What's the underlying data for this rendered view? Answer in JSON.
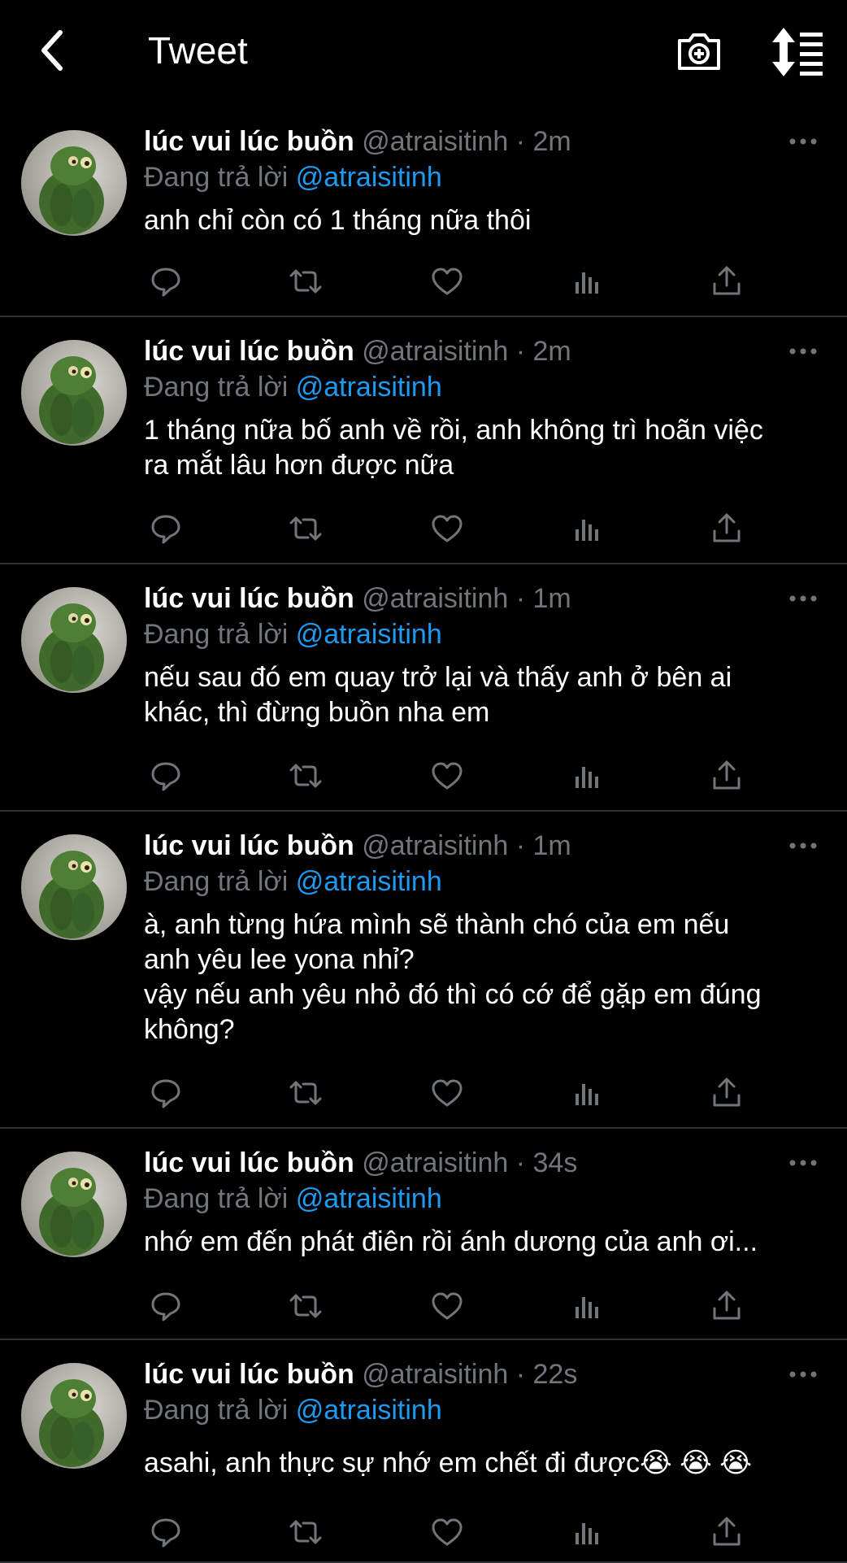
{
  "header": {
    "title": "Tweet",
    "icons": [
      "back-icon",
      "camera-plus-icon",
      "sort-icon"
    ]
  },
  "tweets": [
    {
      "name": "lúc vui lúc buồn",
      "handle": "@atraisitinh",
      "separator": "·",
      "time": "2m",
      "reply_prefix": "Đang trả lời",
      "reply_to": "@atraisitinh",
      "text": "anh chỉ còn có 1 tháng nữa thôi"
    },
    {
      "name": "lúc vui lúc buồn",
      "handle": "@atraisitinh",
      "separator": "·",
      "time": "2m",
      "reply_prefix": "Đang trả lời",
      "reply_to": "@atraisitinh",
      "text": "1 tháng nữa bố anh về rồi, anh không trì hoãn việc\nra mắt lâu hơn được nữa"
    },
    {
      "name": "lúc vui lúc buồn",
      "handle": "@atraisitinh",
      "separator": "·",
      "time": "1m",
      "reply_prefix": "Đang trả lời",
      "reply_to": "@atraisitinh",
      "text": "nếu sau đó em quay trở lại và thấy anh ở bên ai\nkhác, thì đừng buồn nha em"
    },
    {
      "name": "lúc vui lúc buồn",
      "handle": "@atraisitinh",
      "separator": "·",
      "time": "1m",
      "reply_prefix": "Đang trả lời",
      "reply_to": "@atraisitinh",
      "text": "à, anh từng hứa mình sẽ thành chó của em nếu\nanh yêu lee yona nhỉ?\nvậy nếu anh yêu nhỏ đó thì có cớ để gặp em đúng\nkhông?"
    },
    {
      "name": "lúc vui lúc buồn",
      "handle": "@atraisitinh",
      "separator": "·",
      "time": "34s",
      "reply_prefix": "Đang trả lời",
      "reply_to": "@atraisitinh",
      "text": "nhớ em đến phát điên rồi ánh dương của anh ơi..."
    },
    {
      "name": "lúc vui lúc buồn",
      "handle": "@atraisitinh",
      "separator": "·",
      "time": "22s",
      "reply_prefix": "Đang trả lời",
      "reply_to": "@atraisitinh",
      "text": "asahi, anh thực sự nhớ em chết đi được😭 😭 😭"
    }
  ],
  "action_icons": [
    "reply-icon",
    "retweet-icon",
    "like-icon",
    "views-icon",
    "share-icon"
  ],
  "colors": {
    "background": "#000000",
    "text_primary": "#ffffff",
    "text_secondary": "#71767b",
    "link": "#1d9bf0",
    "divider": "#2f3336"
  }
}
